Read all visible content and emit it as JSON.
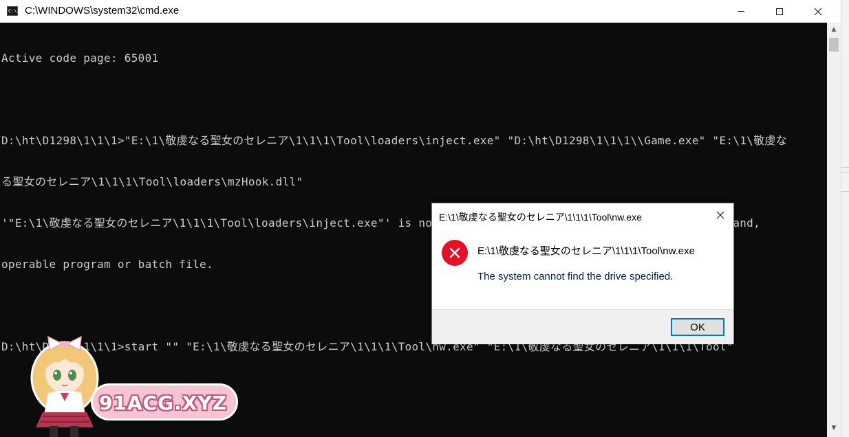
{
  "window": {
    "title": "C:\\WINDOWS\\system32\\cmd.exe",
    "icon": "cmd-icon",
    "controls": {
      "minimize": "minimize",
      "maximize": "maximize",
      "close": "close"
    }
  },
  "console": {
    "lines": [
      "Active code page: 65001",
      "",
      "D:\\ht\\D1298\\1\\1\\1>\"E:\\1\\敬虔なる聖女のセレニア\\1\\1\\1\\Tool\\loaders\\inject.exe\" \"D:\\ht\\D1298\\1\\1\\1\\\\Game.exe\" \"E:\\1\\敬虔な",
      "る聖女のセレニア\\1\\1\\1\\Tool\\loaders\\mzHook.dll\"",
      "'\"E:\\1\\敬虔なる聖女のセレニア\\1\\1\\1\\Tool\\loaders\\inject.exe\"' is not recognized as an internal or external command,",
      "operable program or batch file.",
      "",
      "D:\\ht\\D1298\\1\\1\\1>start \"\" \"E:\\1\\敬虔なる聖女のセレニア\\1\\1\\1\\Tool\\nw.exe\" \"E:\\1\\敬虔なる聖女のセレニア\\1\\1\\1\\Tool\""
    ]
  },
  "dialog": {
    "title": "E:\\1\\敬虔なる聖女のセレニア\\1\\1\\1\\Tool\\nw.exe",
    "path": "E:\\1\\敬虔なる聖女のセレニア\\1\\1\\1\\Tool\\nw.exe",
    "message": "The system cannot find the drive specified.",
    "ok_label": "OK",
    "icon": "error-icon"
  },
  "watermark": {
    "text": "91ACG.XYZ"
  },
  "colors": {
    "console_bg": "#0c0c0c",
    "console_fg": "#cccccc",
    "error_red": "#e81123",
    "focus_blue": "#0078d7"
  }
}
